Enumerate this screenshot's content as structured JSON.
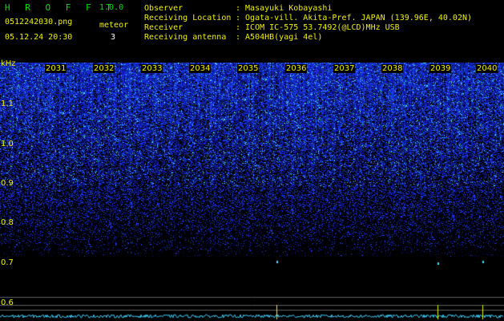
{
  "app": {
    "name": "H R O F F T",
    "version": "1.0.0"
  },
  "file": {
    "name": "0512242030.png",
    "datetime": "05.12.24 20:30"
  },
  "meteor": {
    "label": "meteor",
    "count": "3"
  },
  "info": {
    "observer_label": "Observer",
    "observer_value": ": Masayuki Kobayashi",
    "location_label": "Receiving Location",
    "location_value": ": Ogata-vill. Akita-Pref. JAPAN (139.96E, 40.02N)",
    "receiver_label": "Receiver",
    "receiver_value": ": ICOM IC-575 53.7492(@LCD)MHz USB",
    "antenna_label": "Receiving antenna",
    "antenna_value": ": A504HB(yagi 4el)"
  },
  "axis": {
    "y_unit": "kHz",
    "y_ticks": [
      "1.1",
      "1.0",
      "0.9",
      "0.8",
      "0.7",
      "0.6"
    ],
    "x_ticks": [
      "2031",
      "2032",
      "2033",
      "2034",
      "2035",
      "2036",
      "2037",
      "2038",
      "2039",
      "2040"
    ]
  },
  "colors": {
    "background": "#000000",
    "label_yellow": "#f0f000",
    "label_green": "#00e000",
    "noise_blue": "#2040ff",
    "noise_cyan": "#40e0ff",
    "meteor_trace": "#f0f000"
  }
}
